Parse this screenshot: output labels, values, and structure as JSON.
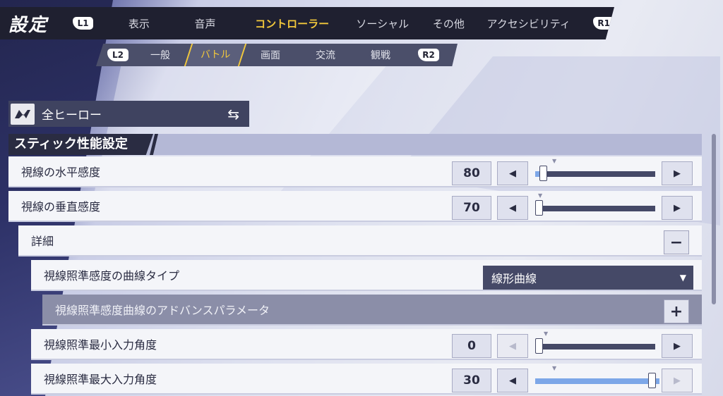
{
  "header": {
    "title": "設定",
    "left_bumper": "L1",
    "right_bumper": "R1",
    "tabs": [
      {
        "label": "表示",
        "active": false
      },
      {
        "label": "音声",
        "active": false
      },
      {
        "label": "コントローラー",
        "active": true
      },
      {
        "label": "ソーシャル",
        "active": false
      },
      {
        "label": "その他",
        "active": false
      },
      {
        "label": "アクセシビリティ",
        "active": false
      }
    ]
  },
  "subheader": {
    "left_bumper": "L2",
    "right_bumper": "R2",
    "tabs": [
      {
        "label": "一般",
        "active": false
      },
      {
        "label": "バトル",
        "active": true
      },
      {
        "label": "画面",
        "active": false
      },
      {
        "label": "交流",
        "active": false
      },
      {
        "label": "観戦",
        "active": false
      }
    ]
  },
  "hero_selector": {
    "label": "全ヒーロー",
    "icon": "hero-logo-icon",
    "swap_icon": "swap-arrows-icon"
  },
  "section": {
    "title": "スティック性能設定"
  },
  "rows": {
    "horizontal": {
      "label": "視線の水平感度",
      "value": "80",
      "fraction": 0.04
    },
    "vertical": {
      "label": "視線の垂直感度",
      "value": "70",
      "fraction": 0.0
    },
    "details": {
      "label": "詳細",
      "toggle": "−"
    },
    "curve_type": {
      "label": "視線照準感度の曲線タイプ",
      "value": "線形曲線"
    },
    "advanced": {
      "label": "視線照準感度曲線のアドバンスパラメータ",
      "toggle": "+"
    },
    "min_angle": {
      "label": "視線照準最小入力角度",
      "value": "0",
      "fraction": 0.0
    },
    "max_angle": {
      "label": "視線照準最大入力角度",
      "value": "30",
      "fraction": 1.0
    }
  },
  "colors": {
    "accent": "#f2c83b",
    "slider_fill": "#7da7e8",
    "bar_dark": "#1f2030"
  }
}
